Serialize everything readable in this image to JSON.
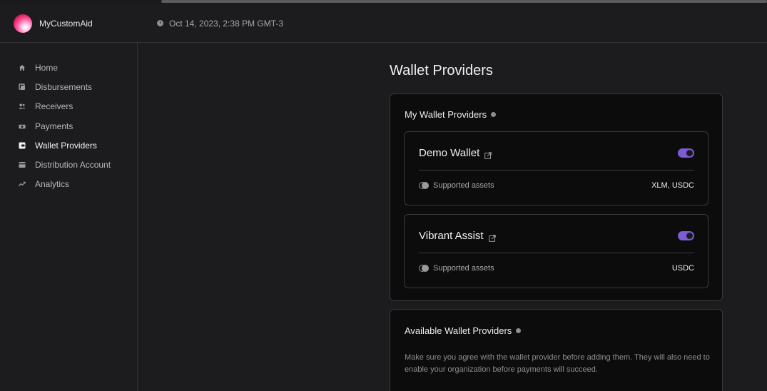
{
  "app": {
    "name": "MyCustomAid",
    "timestamp": "Oct 14, 2023, 2:38 PM GMT-3"
  },
  "sidebar": {
    "items": [
      {
        "label": "Home",
        "icon": "home-icon"
      },
      {
        "label": "Disbursements",
        "icon": "disbursements-icon"
      },
      {
        "label": "Receivers",
        "icon": "receivers-icon"
      },
      {
        "label": "Payments",
        "icon": "payments-icon"
      },
      {
        "label": "Wallet Providers",
        "icon": "wallet-icon",
        "active": true
      },
      {
        "label": "Distribution Account",
        "icon": "distribution-account-icon"
      },
      {
        "label": "Analytics",
        "icon": "analytics-icon"
      }
    ]
  },
  "main": {
    "title": "Wallet Providers",
    "my_providers": {
      "title": "My Wallet Providers",
      "wallets": [
        {
          "name": "Demo Wallet",
          "assets_label": "Supported assets",
          "assets": "XLM, USDC",
          "enabled": true
        },
        {
          "name": "Vibrant Assist",
          "assets_label": "Supported assets",
          "assets": "USDC",
          "enabled": true
        }
      ]
    },
    "available_providers": {
      "title": "Available Wallet Providers",
      "description": "Make sure you agree with the wallet provider before adding them. They will also need to enable your organization before payments will succeed."
    }
  },
  "colors": {
    "accent": "#7b5bd6",
    "background": "#1c1c1e",
    "panel": "#0c0c0d"
  }
}
